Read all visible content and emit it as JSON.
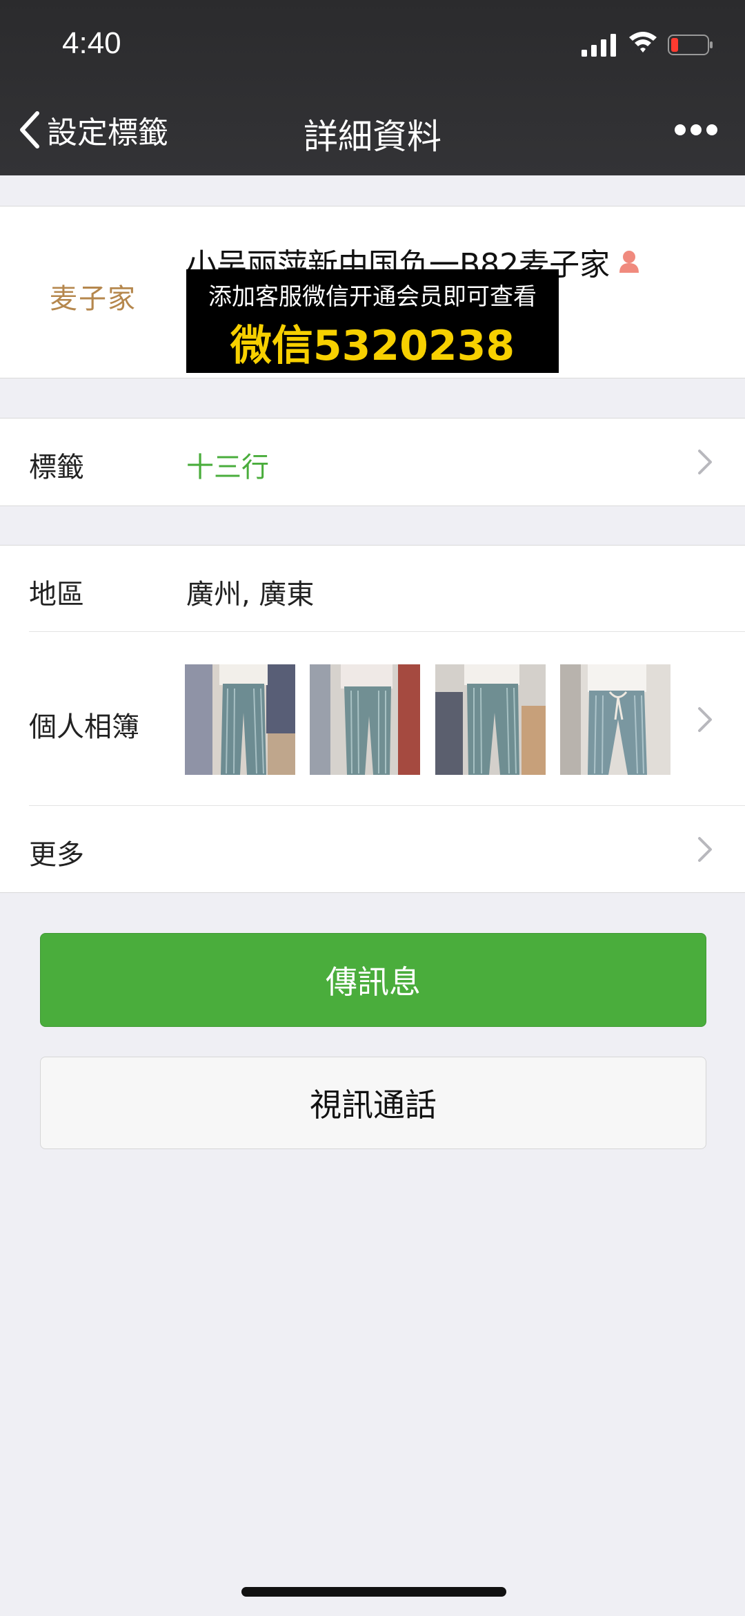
{
  "status_bar": {
    "time": "4:40"
  },
  "nav": {
    "back_label": "設定標籤",
    "title": "詳細資料"
  },
  "profile": {
    "avatar_text": "麦子家",
    "name": "小吴丽萍新中国负一B82麦子家"
  },
  "overlay_ad": {
    "line1": "添加客服微信开通会员即可查看",
    "line2": "微信5320238",
    "text_color": "#f7d000"
  },
  "tag_row": {
    "label": "標籤",
    "value": "十三行",
    "value_color": "#4aad3c"
  },
  "region_row": {
    "label": "地區",
    "value": "廣州, 廣東"
  },
  "album_row": {
    "label": "個人相簿",
    "thumbnails": [
      "jeans-photo-1",
      "jeans-photo-2",
      "jeans-photo-3",
      "jeans-photo-4"
    ]
  },
  "more_row": {
    "label": "更多"
  },
  "buttons": {
    "message": "傳訊息",
    "video_call": "視訊通話"
  },
  "colors": {
    "accent": "#4aad3c",
    "background": "#efeff4",
    "navbar": "#2f2f31"
  }
}
